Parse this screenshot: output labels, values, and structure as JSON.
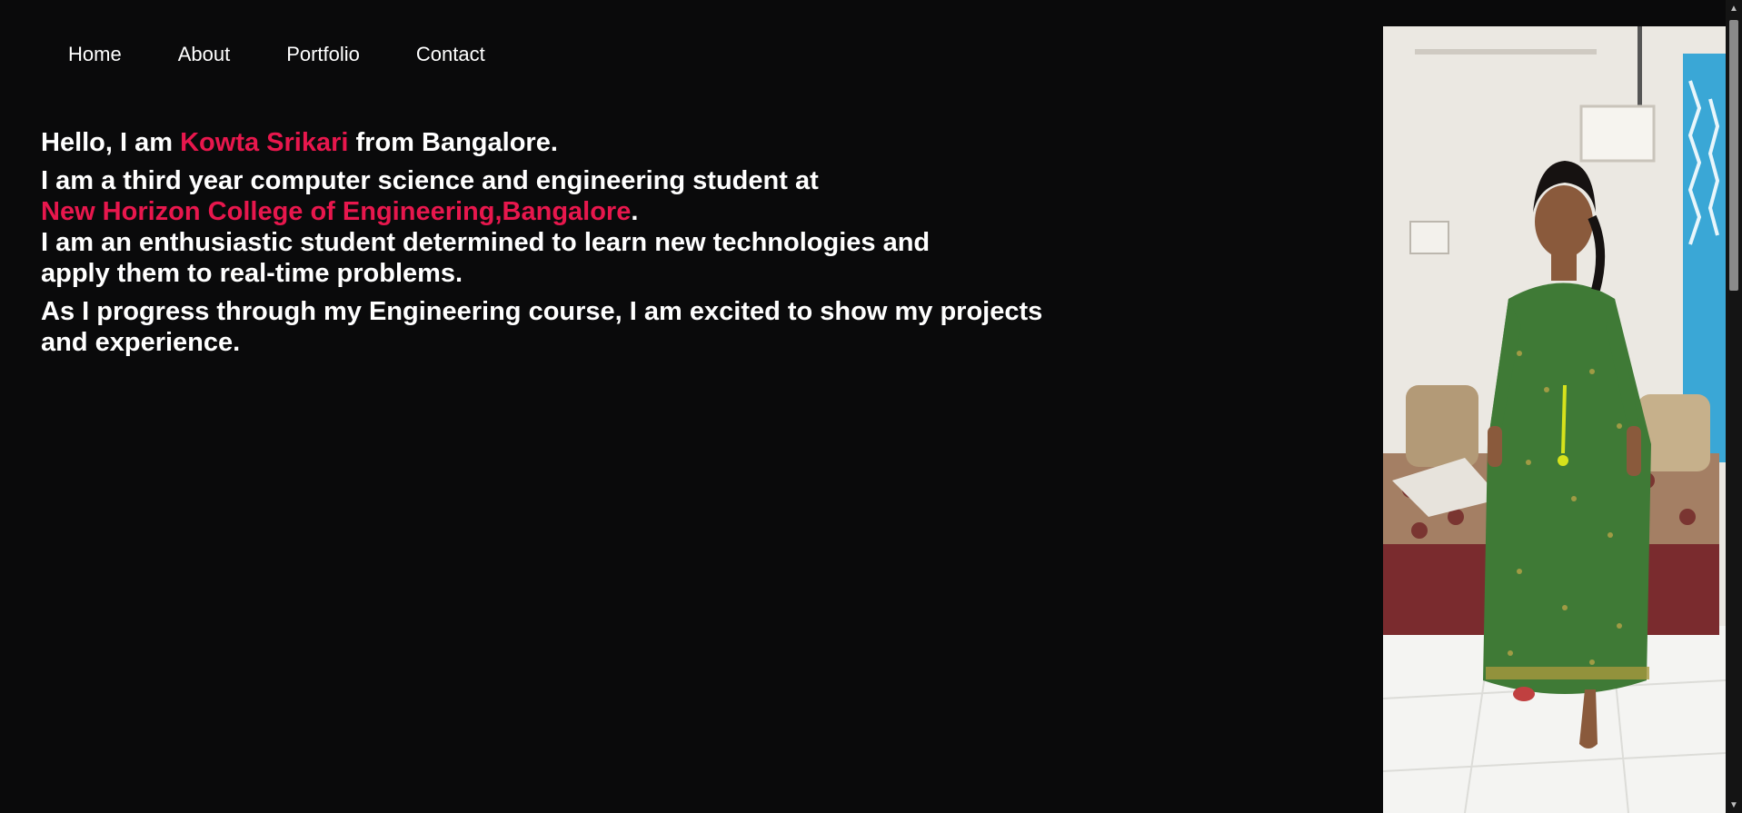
{
  "nav": {
    "items": [
      "Home",
      "About",
      "Portfolio",
      "Contact"
    ]
  },
  "intro": {
    "greeting_prefix": "Hello, I am ",
    "name": "Kowta Srikari",
    "greeting_suffix": " from Bangalore.",
    "line2": "I am a third year computer science and engineering student at",
    "college": "New Horizon College of Engineering,Bangalore",
    "college_suffix": ".",
    "line3a": "I am an enthusiastic student determined to learn new technologies and",
    "line3b": "apply them to real-time problems.",
    "line4a": "As I progress through my Engineering course, I am excited to show my projects",
    "line4b": "and experience."
  },
  "colors": {
    "background": "#0a0a0b",
    "text": "#ffffff",
    "accent": "#e8174d"
  },
  "photo": {
    "icon": "profile-photo"
  },
  "scrollbar": {
    "up_icon": "▲",
    "down_icon": "▼"
  }
}
